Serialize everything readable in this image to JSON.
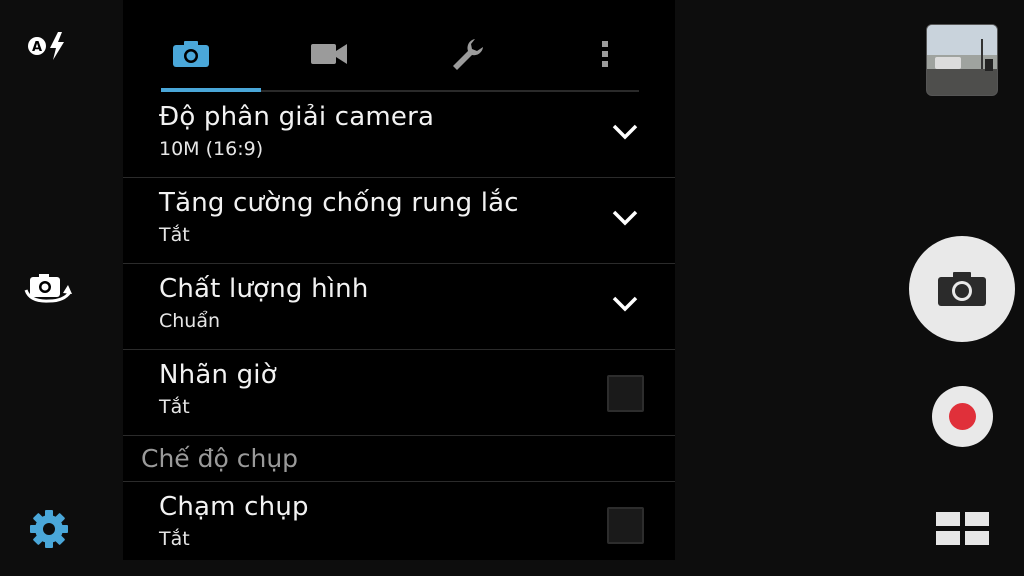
{
  "settings": {
    "rows": [
      {
        "title": "Độ phân giải camera",
        "value": "10M (16:9)",
        "control": "dropdown"
      },
      {
        "title": "Tăng cường chống rung lắc",
        "value": "Tắt",
        "control": "dropdown"
      },
      {
        "title": "Chất lượng hình",
        "value": "Chuẩn",
        "control": "dropdown"
      },
      {
        "title": "Nhãn giờ",
        "value": "Tắt",
        "control": "checkbox",
        "checked": false
      }
    ],
    "section_label": "Chế độ chụp",
    "section_rows": [
      {
        "title": "Chạm chụp",
        "value": "Tắt",
        "control": "checkbox",
        "checked": false
      }
    ]
  },
  "tabs": [
    {
      "icon": "camera-icon",
      "active": true
    },
    {
      "icon": "video-camera-icon",
      "active": false
    },
    {
      "icon": "wrench-icon",
      "active": false
    },
    {
      "icon": "more-vertical-icon",
      "active": false
    }
  ],
  "left_controls": {
    "flash_mode_letter": "A",
    "icons": [
      "flash-auto-icon",
      "switch-camera-icon",
      "gear-icon"
    ]
  },
  "colors": {
    "accent": "#4aa7d9",
    "record": "#e0303a",
    "panel_bg": "#000000",
    "secondary_text": "#9a9a9a"
  }
}
